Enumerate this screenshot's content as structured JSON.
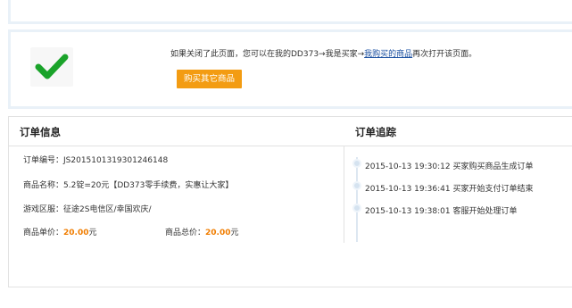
{
  "success": {
    "notice_prefix": "如果关闭了此页面，您可以在我的DD373→我是买家→",
    "notice_link": "我购买的商品",
    "notice_suffix": "再次打开该页面。",
    "buy_button": "购买其它商品"
  },
  "order_info": {
    "title": "订单信息",
    "order_no_label": "订单编号：",
    "order_no": "JS2015101319301246148",
    "product_label": "商品名称：",
    "product": "5.2锭=20元【DD373零手续费，实惠让大家】",
    "zone_label": "游戏区服：",
    "zone": "征途2S电信区/幸国欢庆/",
    "unit_price_label": "商品单价：",
    "unit_price": "20.00",
    "total_label": "商品总价：",
    "total": "20.00",
    "currency": "元"
  },
  "tracking": {
    "title": "订单追踪",
    "events": [
      {
        "time": "2015-10-13 19:30:12",
        "text": "买家购买商品生成订单"
      },
      {
        "time": "2015-10-13 19:36:41",
        "text": "买家开始支付订单结束"
      },
      {
        "time": "2015-10-13 19:38:01",
        "text": "客服开始处理订单"
      }
    ]
  },
  "colors": {
    "accent_orange": "#f39c12",
    "price_orange": "#f07d00",
    "check_green": "#1aa32a",
    "link_blue": "#1a4fa0"
  }
}
